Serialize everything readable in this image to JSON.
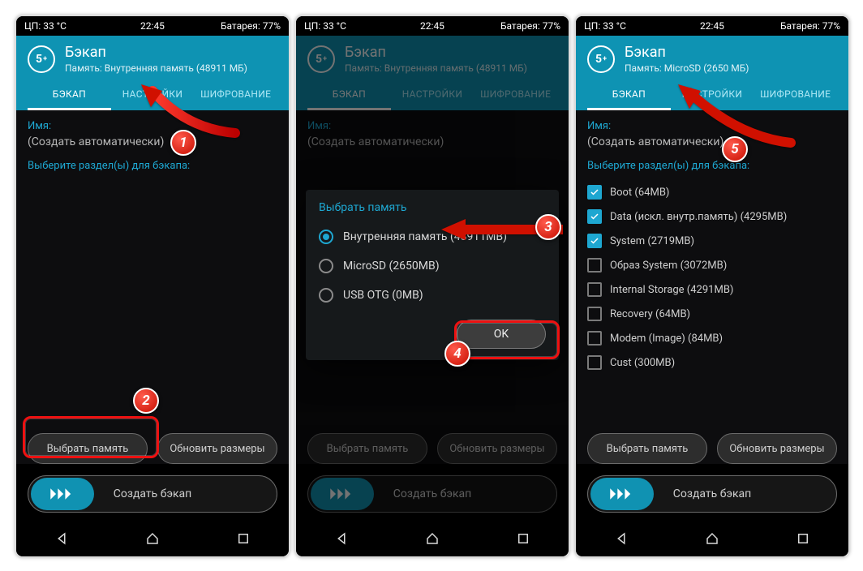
{
  "status": {
    "cpu": "ЦП: 33 °C",
    "time": "22:45",
    "battery": "Батарея: 77%"
  },
  "header": {
    "title": "Бэкап",
    "icon_text": "5",
    "storage_internal": "Память: Внутренняя память (48911 МБ)",
    "storage_sd": "Память: MicroSD (2650 МБ)"
  },
  "tabs": {
    "backup": "БЭКАП",
    "settings": "НАСТРОЙКИ",
    "encrypt": "ШИФРОВАНИЕ"
  },
  "labels": {
    "name": "Имя:",
    "auto": "(Создать автоматически)",
    "select_partitions": "Выберите раздел(ы) для бэкапa:"
  },
  "buttons": {
    "choose_storage": "Выбрать память",
    "refresh_sizes": "Обновить размеры",
    "create_backup": "Создать бэкап",
    "ok": "OK"
  },
  "dialog": {
    "title": "Выбрать память",
    "opt_internal": "Внутренняя память (48911MB)",
    "opt_sd": "MicroSD (2650MB)",
    "opt_usb": "USB OTG (0MB)"
  },
  "partitions": {
    "boot": "Boot (64MB)",
    "data": "Data (искл. внутр.память) (4295MB)",
    "system": "System (2719MB)",
    "sysimg": "Образ System (3072MB)",
    "intstor": "Internal Storage (4291MB)",
    "recovery": "Recovery (64MB)",
    "modem": "Modem (Image) (84MB)",
    "cust": "Cust (300MB)"
  },
  "badges": {
    "b1": "1",
    "b2": "2",
    "b3": "3",
    "b4": "4",
    "b5": "5"
  }
}
